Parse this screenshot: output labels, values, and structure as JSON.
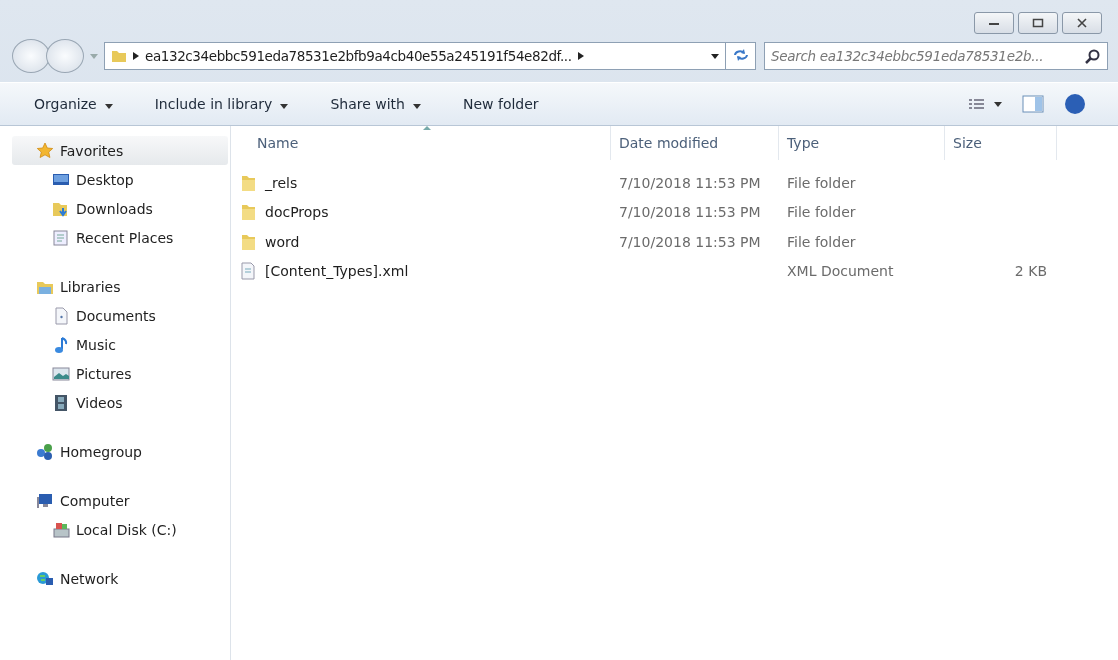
{
  "address_bar": {
    "path": "ea132c34ebbc591eda78531e2bfb9a4cb40e55a245191f54e82df..."
  },
  "search": {
    "placeholder": "Search ea132c34ebbc591eda78531e2b..."
  },
  "toolbar": [
    {
      "label": "Organize",
      "dropdown": true
    },
    {
      "label": "Include in library",
      "dropdown": true
    },
    {
      "label": "Share with",
      "dropdown": true
    },
    {
      "label": "New folder",
      "dropdown": false
    }
  ],
  "sidebar": {
    "groups": [
      {
        "label": "Favorites",
        "kind": "star",
        "selected": true,
        "children": [
          {
            "label": "Desktop",
            "kind": "desktop",
            "selected": false
          },
          {
            "label": "Downloads",
            "kind": "downloads",
            "selected": false
          },
          {
            "label": "Recent Places",
            "kind": "recent",
            "selected": false
          }
        ]
      },
      {
        "label": "Libraries",
        "kind": "libraries",
        "selected": false,
        "children": [
          {
            "label": "Documents",
            "kind": "document",
            "selected": false
          },
          {
            "label": "Music",
            "kind": "music",
            "selected": false
          },
          {
            "label": "Pictures",
            "kind": "pictures",
            "selected": false
          },
          {
            "label": "Videos",
            "kind": "videos",
            "selected": false
          }
        ]
      },
      {
        "label": "Homegroup",
        "kind": "homegroup",
        "selected": false
      },
      {
        "label": "Computer",
        "kind": "computer",
        "selected": false,
        "children": [
          {
            "label": "Local Disk (C:)",
            "kind": "disk",
            "selected": false
          }
        ]
      },
      {
        "label": "Network",
        "kind": "network",
        "selected": false
      }
    ]
  },
  "table": {
    "columns": [
      "Name",
      "Date modified",
      "Type",
      "Size"
    ],
    "rows": [
      {
        "name": "_rels",
        "date_modified": "7/10/2018 11:53 PM",
        "type": "File folder",
        "kind": "folder"
      },
      {
        "name": "docProps",
        "date_modified": "7/10/2018 11:53 PM",
        "type": "File folder",
        "kind": "folder"
      },
      {
        "name": "word",
        "date_modified": "7/10/2018 11:53 PM",
        "type": "File folder",
        "kind": "folder"
      },
      {
        "name": "[Content_Types].xml",
        "type": "XML Document",
        "size": "2 KB",
        "kind": "file"
      }
    ]
  }
}
